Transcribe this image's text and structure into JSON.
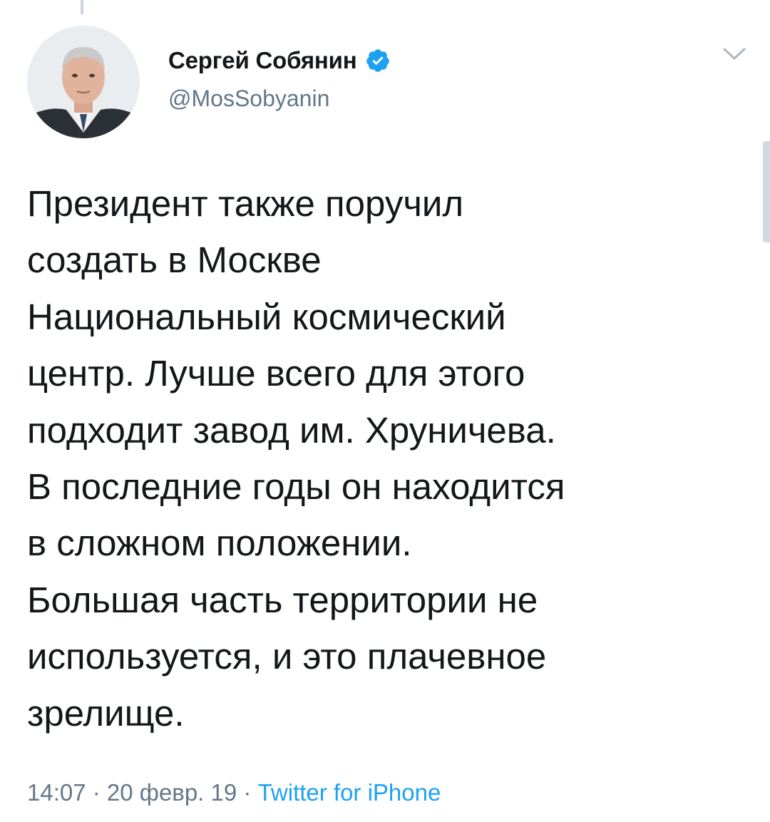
{
  "tweet": {
    "author": {
      "display_name": "Сергей Собянин",
      "handle": "@MosSobyanin",
      "verified": true,
      "avatar": "portrait-photo"
    },
    "text": "Президент также поручил\nсоздать в Москве\nНациональный космический\nцентр. Лучше всего для этого\nподходит завод им. Хруничева.\nВ последние годы он находится\nв сложном положении.\nБольшая часть территории не\nиспользуется, и это плачевное\nзрелище.",
    "time": "14:07",
    "date": "20 февр. 19",
    "separator": " · ",
    "source": "Twitter for iPhone"
  },
  "icons": {
    "verified": "verified-badge-icon",
    "menu": "chevron-down-icon"
  },
  "colors": {
    "verified_blue": "#1da1f2",
    "link": "#1da1f2",
    "secondary_text": "#657786",
    "primary_text": "#14171a"
  }
}
